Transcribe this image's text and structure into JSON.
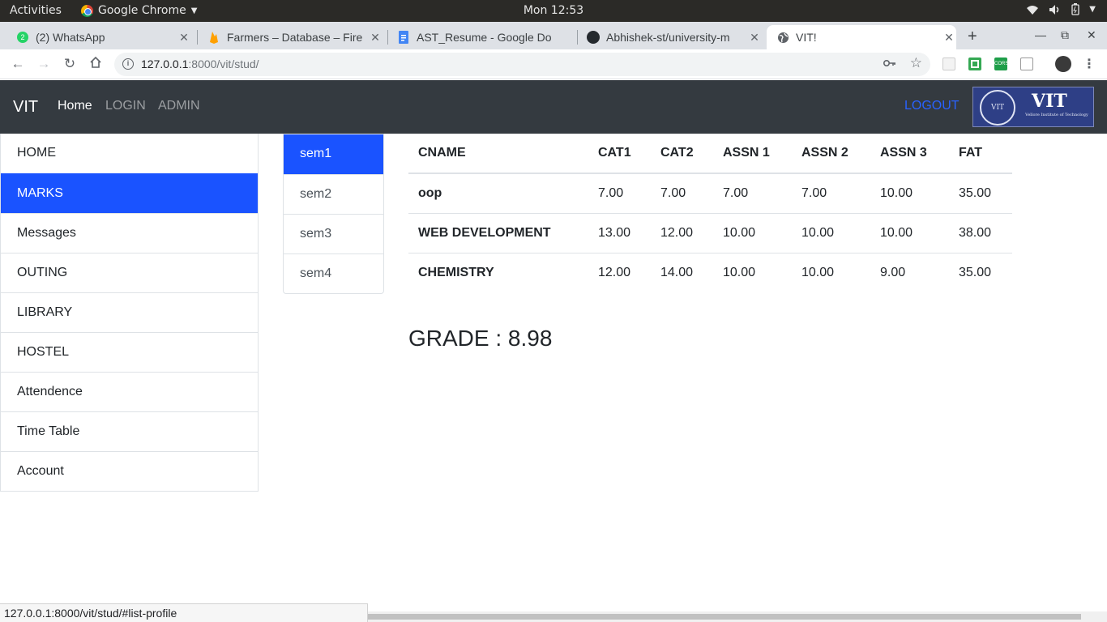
{
  "os_bar": {
    "activities": "Activities",
    "app_name": "Google Chrome",
    "clock": "Mon 12:53"
  },
  "tabs": [
    {
      "title": "(2) WhatsApp",
      "icon": "whatsapp-icon"
    },
    {
      "title": "Farmers – Database – Fire",
      "icon": "firebase-icon"
    },
    {
      "title": "AST_Resume - Google Do",
      "icon": "google-docs-icon"
    },
    {
      "title": "Abhishek-st/university-m",
      "icon": "github-icon"
    },
    {
      "title": "VIT!",
      "icon": "globe-icon",
      "active": true
    }
  ],
  "address_bar": {
    "host": "127.0.0.1",
    "path": ":8000/vit/stud/"
  },
  "navbar": {
    "brand": "VIT",
    "links": [
      "Home",
      "LOGIN",
      "ADMIN"
    ],
    "logout": "LOGOUT",
    "logo_text": "VIT",
    "logo_seal_text": "VIT",
    "logo_subtitle": "Vellore Institute of Technology"
  },
  "sidebar": {
    "items": [
      "HOME",
      "MARKS",
      "Messages",
      "OUTING",
      "LIBRARY",
      "HOSTEL",
      "Attendence",
      "Time Table",
      "Account"
    ],
    "active_index": 1
  },
  "semesters": {
    "items": [
      "sem1",
      "sem2",
      "sem3",
      "sem4"
    ],
    "active_index": 0
  },
  "marks_table": {
    "headers": [
      "CNAME",
      "CAT1",
      "CAT2",
      "ASSN 1",
      "ASSN 2",
      "ASSN 3",
      "FAT"
    ],
    "rows": [
      [
        "oop",
        "7.00",
        "7.00",
        "7.00",
        "7.00",
        "10.00",
        "35.00"
      ],
      [
        "WEB DEVELOPMENT",
        "13.00",
        "12.00",
        "10.00",
        "10.00",
        "10.00",
        "38.00"
      ],
      [
        "CHEMISTRY",
        "12.00",
        "14.00",
        "10.00",
        "10.00",
        "9.00",
        "35.00"
      ]
    ]
  },
  "grade": "GRADE : 8.98",
  "status_url": "127.0.0.1:8000/vit/stud/#list-profile",
  "colors": {
    "navbar_bg": "#343a40",
    "active_blue": "#1a53ff",
    "logout_blue": "#2962ff"
  }
}
